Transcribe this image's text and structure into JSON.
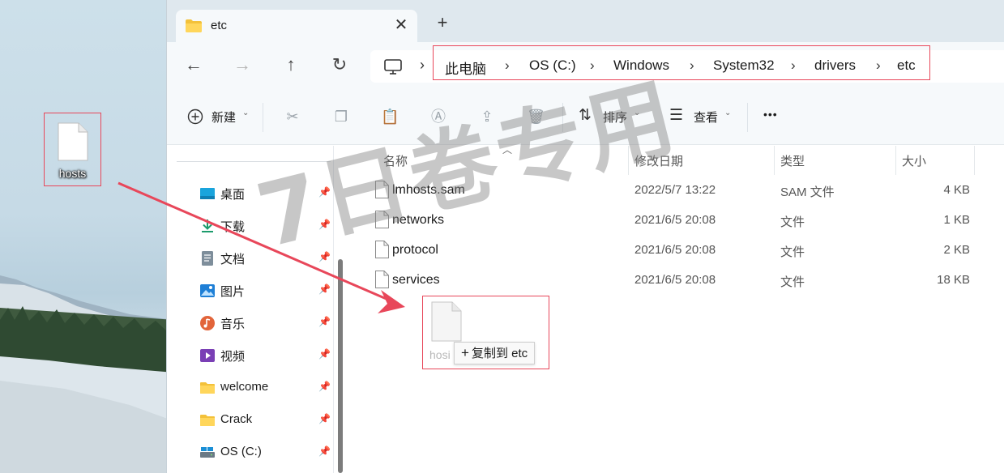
{
  "desktop": {
    "icon_label": "hosts"
  },
  "tab": {
    "title": "etc",
    "close": "✕",
    "new_tab": "+"
  },
  "nav": {
    "back": "←",
    "forward": "→",
    "up": "↑",
    "refresh": "↻"
  },
  "breadcrumb": [
    "此电脑",
    "OS (C:)",
    "Windows",
    "System32",
    "drivers",
    "etc"
  ],
  "toolbar": {
    "new_label": "新建",
    "sort_label": "排序",
    "view_label": "查看",
    "more": "•••"
  },
  "sidebar": {
    "items": [
      {
        "label": "桌面",
        "icon": "desktop-icon"
      },
      {
        "label": "下载",
        "icon": "download-icon"
      },
      {
        "label": "文档",
        "icon": "document-icon"
      },
      {
        "label": "图片",
        "icon": "pictures-icon"
      },
      {
        "label": "音乐",
        "icon": "music-icon"
      },
      {
        "label": "视频",
        "icon": "video-icon"
      },
      {
        "label": "welcome",
        "icon": "folder-icon"
      },
      {
        "label": "Crack",
        "icon": "folder-icon"
      },
      {
        "label": "OS (C:)",
        "icon": "drive-icon"
      }
    ]
  },
  "columns": {
    "name": "名称",
    "date": "修改日期",
    "type": "类型",
    "size": "大小"
  },
  "files": [
    {
      "name": "lmhosts.sam",
      "date": "2022/5/7 13:22",
      "type": "SAM 文件",
      "size": "4 KB"
    },
    {
      "name": "networks",
      "date": "2021/6/5 20:08",
      "type": "文件",
      "size": "1 KB"
    },
    {
      "name": "protocol",
      "date": "2021/6/5 20:08",
      "type": "文件",
      "size": "2 KB"
    },
    {
      "name": "services",
      "date": "2021/6/5 20:08",
      "type": "文件",
      "size": "18 KB"
    }
  ],
  "drag": {
    "ghost_name": "hosi",
    "tooltip": "复制到 etc",
    "tooltip_plus": "+"
  },
  "watermark": "7日卷专用",
  "colors": {
    "highlight_border": "#e8475a",
    "arrow": "#e8475a"
  }
}
